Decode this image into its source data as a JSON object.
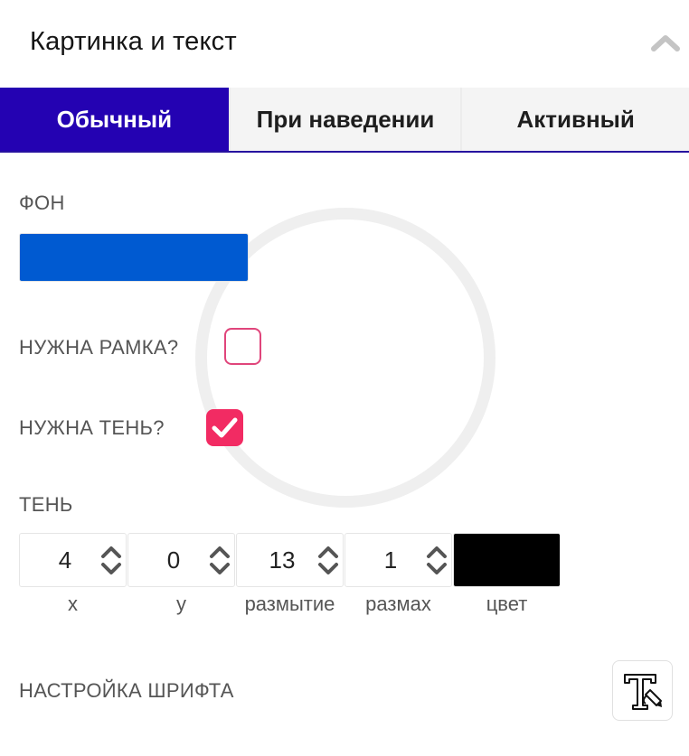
{
  "header": {
    "title": "Картинка и текст"
  },
  "tabs": [
    {
      "label": "Обычный",
      "active": true
    },
    {
      "label": "При наведении",
      "active": false
    },
    {
      "label": "Активный",
      "active": false
    }
  ],
  "background": {
    "label": "ФОН",
    "color": "#005ad1"
  },
  "border": {
    "label": "НУЖНА РАМКА?",
    "checked": false
  },
  "shadow_toggle": {
    "label": "НУЖНА ТЕНЬ?",
    "checked": true
  },
  "shadow": {
    "label": "ТЕНЬ",
    "fields": [
      {
        "caption": "x",
        "value": "4"
      },
      {
        "caption": "y",
        "value": "0"
      },
      {
        "caption": "размытие",
        "value": "13"
      },
      {
        "caption": "размах",
        "value": "1"
      }
    ],
    "color_caption": "цвет",
    "color": "#000000"
  },
  "font": {
    "label": "НАСТРОЙКА ШРИФТА",
    "icon": "font-settings-icon"
  },
  "colors": {
    "accent": "#2402b2",
    "checkbox": "#f22b63",
    "checkbox_border": "#e0457b"
  }
}
